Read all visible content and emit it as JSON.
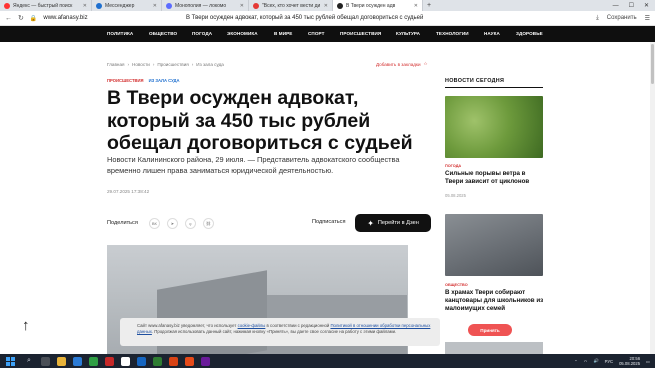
{
  "browser": {
    "tabs": [
      {
        "label": "Яндекс — быстрый поиск",
        "color": "#ff3333",
        "active": false
      },
      {
        "label": "Мессенджер",
        "color": "#1e6fcf",
        "active": false
      },
      {
        "label": "Монополия — локомо",
        "color": "#5b6bff",
        "active": false
      },
      {
        "label": "\"Всех, кто хочет вести ди",
        "color": "#e53935",
        "active": false
      },
      {
        "label": "В Твери осужден адв",
        "color": "#222222",
        "active": true
      }
    ],
    "url": "www.afanasy.biz",
    "page_title": "В Твери осужден адвокат, который за 450 тыс рублей обещал договориться с судьей",
    "save_label": "Сохранить"
  },
  "site_nav": [
    "ПОЛИТИКА",
    "ОБЩЕСТВО",
    "ПОГОДА",
    "ЭКОНОМИКА",
    "В МИРЕ",
    "СПОРТ",
    "ПРОИСШЕСТВИЯ",
    "КУЛЬТУРА",
    "ТЕХНОЛОГИИ",
    "НАУКА",
    "ЗДОРОВЬЕ"
  ],
  "breadcrumbs": [
    "Главная",
    "Новости",
    "Происшествия",
    "Из зала суда"
  ],
  "bookmark_label": "Добавить в закладки",
  "tags": {
    "primary": "ПРОИСШЕСТВИЯ",
    "secondary": "ИЗ ЗАЛА СУДА"
  },
  "article": {
    "headline": "В Твери осужден адвокат, который за 450 тыс рублей обещал договориться с судьей",
    "lead": "Новости Калининского района, 29 июля. — Представитель адвокатского сообщества временно лишен права заниматься юридической деятельностью.",
    "datetime": "29.07.2025 17:38:42"
  },
  "share": {
    "label": "Поделиться",
    "icons": [
      "ВК",
      "TG",
      "OK",
      "LINK"
    ],
    "subscribe_label": "Подписаться",
    "dzen_label": "Перейти в Дзен"
  },
  "sidebar": {
    "title": "НОВОСТИ СЕГОДНЯ",
    "items": [
      {
        "category": "ПОГОДА",
        "headline": "Сильные порывы ветра в Твери зависит от циклонов",
        "date": "05.08.2025"
      },
      {
        "category": "ОБЩЕСТВО",
        "headline": "В храмах Твери собирают канцтовары для школьников из малоимущих семей",
        "date": ""
      }
    ]
  },
  "cookie": {
    "text_1": "Сайт www.afanasy.biz уведомляет, что использует ",
    "link_1": "cookie-файлы",
    "text_2": " в соответствии с редакционной ",
    "link_2": "Политикой в отношении обработки персональных данных",
    "text_3": ". Продолжая использовать данный сайт, нажимая кнопку «Принять», вы даете свое согласие на работу с этими файлами.",
    "accept_label": "Принять"
  },
  "taskbar": {
    "lang": "РУС",
    "time": "20:56",
    "date": "05.08.2025"
  },
  "colors": {
    "accent": "#d32f2f",
    "link": "#1e6fcf",
    "nav_bg": "#0f0f0f",
    "cookie_btn": "#ef5353"
  }
}
